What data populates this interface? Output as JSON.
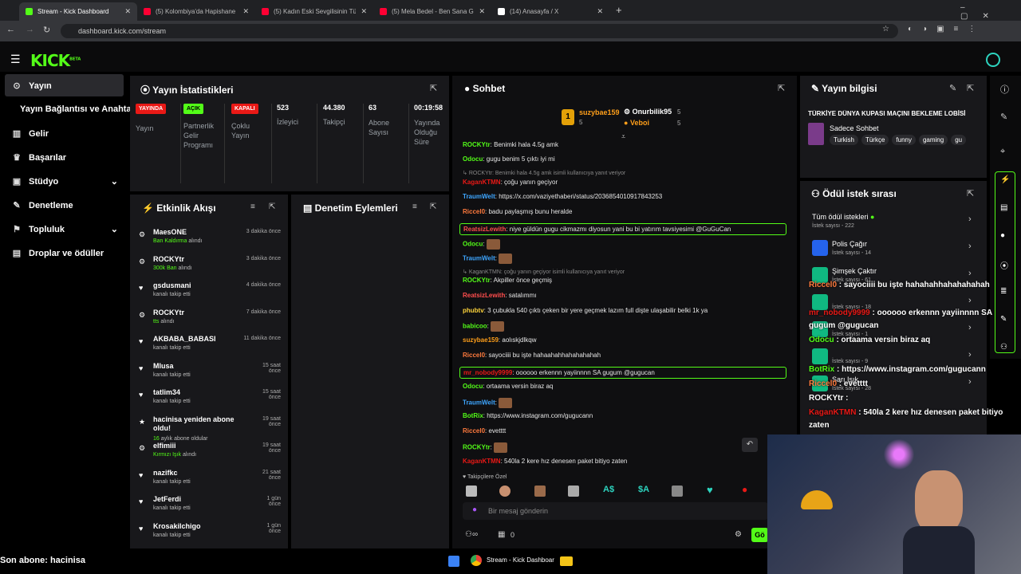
{
  "browser": {
    "tabs": [
      {
        "title": "Stream - Kick Dashboard",
        "color": "#53fc18"
      },
      {
        "title": "(5) Kolombiya'da Hapishane Ba",
        "color": "#ff0033"
      },
      {
        "title": "(5) Kadın Eski Sevgilisinin Tüm",
        "color": "#ff0033"
      },
      {
        "title": "(5) Mela Bedel - Ben Sana Gele",
        "color": "#ff0033"
      },
      {
        "title": "(14) Anasayfa / X",
        "color": "#ffffff"
      }
    ],
    "url": "dashboard.kick.com/stream"
  },
  "app": {
    "logo": "KICK",
    "logo_sup": "BETA"
  },
  "sidebar": {
    "items": [
      "Yayın",
      "Yayın Bağlantısı ve Anahtarı",
      "Gelir",
      "Başarılar",
      "Stüdyo",
      "Denetleme",
      "Topluluk",
      "Droplar ve ödüller"
    ]
  },
  "stats": {
    "title": "Yayın İstatistikleri",
    "items": [
      {
        "badge": "YAYINDA",
        "label": "Yayın",
        "color": "#e91916"
      },
      {
        "badge": "AÇIK",
        "label": "Partnerlik Gelir Programı",
        "color": "#53fc18"
      },
      {
        "badge": "KAPALI",
        "label": "Çoklu Yayın",
        "color": "#e91916"
      },
      {
        "value": "523",
        "label": "İzleyici"
      },
      {
        "value": "44.380",
        "label": "Takipçi"
      },
      {
        "value": "63",
        "label": "Abone Sayısı"
      },
      {
        "value": "00:19:58",
        "label": "Yayında Olduğu Süre"
      }
    ]
  },
  "activity": {
    "title": "Etkinlik Akışı",
    "items": [
      {
        "name": "MaesONE",
        "sub": "Ban Kaldırma",
        "sub2": " alındı",
        "time": "3 dakika önce",
        "icon": "⚙"
      },
      {
        "name": "ROCKYtr",
        "sub": "300k Ban",
        "sub2": " alındı",
        "time": "3 dakika önce",
        "icon": "⚙"
      },
      {
        "name": "gsdusmani",
        "sub": "",
        "sub2": "kanalı takip etti",
        "time": "4 dakika önce",
        "icon": "♥"
      },
      {
        "name": "ROCKYtr",
        "sub": "tts",
        "sub2": " alındı",
        "time": "7 dakika önce",
        "icon": "⚙"
      },
      {
        "name": "AKBABA_BABASI",
        "sub": "",
        "sub2": "kanalı takip etti",
        "time": "11 dakika önce",
        "icon": "♥"
      },
      {
        "name": "Mlusa",
        "sub": "",
        "sub2": "kanalı takip etti",
        "time": "15 saat önce",
        "icon": "♥"
      },
      {
        "name": "tatlim34",
        "sub": "",
        "sub2": "kanalı takip etti",
        "time": "15 saat önce",
        "icon": "♥"
      },
      {
        "name": "hacinisa yeniden abone oldu!",
        "sub": "16",
        "sub2": " aylık abone oldular",
        "time": "19 saat önce",
        "icon": "★"
      },
      {
        "name": "elfimiii",
        "sub": "Kırmızı Işık",
        "sub2": " alındı",
        "time": "19 saat önce",
        "icon": "⚙"
      },
      {
        "name": "nazifkc",
        "sub": "",
        "sub2": "kanalı takip etti",
        "time": "21 saat önce",
        "icon": "♥"
      },
      {
        "name": "JetFerdi",
        "sub": "",
        "sub2": "kanalı takip etti",
        "time": "1 gün önce",
        "icon": "♥"
      },
      {
        "name": "Krosakilchigo",
        "sub": "",
        "sub2": "kanalı takip etti",
        "time": "1 gün önce",
        "icon": "♥"
      }
    ]
  },
  "moderation": {
    "title": "Denetim Eylemleri"
  },
  "chat": {
    "title": "Sohbet",
    "top": [
      {
        "name": "suzybae159",
        "count": "5"
      },
      {
        "name": "Onurbilik95",
        "count": "5"
      },
      {
        "name": "Veboi",
        "count": "5"
      }
    ],
    "lines": [
      {
        "user": "ROCKYtr",
        "color": "#53fc18",
        "text": ": Benimki hala 4.5g amk"
      },
      {
        "user": "Odocu",
        "color": "#53fc18",
        "text": ": gugu benim 5 çıktı iyi mi"
      },
      {
        "reply": "ROCKYtr: Benimki hala 4.5g amk isimli kullanıcıya yanıt veriyor"
      },
      {
        "user": "KaganKTMN",
        "color": "#e91916",
        "text": ": çoğu yanın geçiyor"
      },
      {
        "user": "TraumWelt",
        "color": "#3ea6ff",
        "text": ": https://x.com/vaziyethaberi/status/2036854010917843253"
      },
      {
        "user": "Riccel0",
        "color": "#ff7a3d",
        "text": ": badu paylaşmış bunu heralde"
      },
      {
        "user": "ReatsizLewith",
        "color": "#ff4d4d",
        "text": ": niye güldün gugu cikmazmı diyosun yani bu bi yatırım tavsiyesimi @GuGuCan",
        "hl": true
      },
      {
        "user": "Odocu",
        "color": "#53fc18",
        "text": ":"
      },
      {
        "user": "TraumWelt",
        "color": "#3ea6ff",
        "text": ":"
      },
      {
        "reply": "KaganKTMN: çoğu yanın geçiyor isimli kullanıcıya yanıt veriyor"
      },
      {
        "user": "ROCKYtr",
        "color": "#53fc18",
        "text": ": Akpiller önce geçmiş"
      },
      {
        "user": "ReatsizLewith",
        "color": "#ff4d4d",
        "text": ": satalımmı"
      },
      {
        "user": "phubtv",
        "color": "#ffd43b",
        "text": ": 3 çubukla 540 çıktı çeken bir yere geçmek lazım full dişte ulaşabilir belki 1k ya"
      },
      {
        "user": "babicoo",
        "color": "#53fc18",
        "text": ":"
      },
      {
        "user": "suzybae159",
        "color": "#ff9f1a",
        "text": ": aolıskjdlkqw"
      },
      {
        "user": "Riccel0",
        "color": "#ff7a3d",
        "text": ": sayociiii bu işte hahaahahhahahahahah"
      },
      {
        "user": "mr_nobody9999",
        "color": "#e91916",
        "text": ": oooooo erkennn yayiinnnn SA gugum @gugucan",
        "hl": true
      },
      {
        "user": "Odocu",
        "color": "#53fc18",
        "text": ": ortaama versin biraz aq"
      },
      {
        "user": "TraumWelt",
        "color": "#3ea6ff",
        "text": ":"
      },
      {
        "user": "BotRix",
        "color": "#53fc18",
        "text": ": https://www.instagram.com/gugucann"
      },
      {
        "user": "Riccel0",
        "color": "#ff7a3d",
        "text": ": evetttt"
      },
      {
        "user": "ROCKYtr",
        "color": "#53fc18",
        "text": ":"
      },
      {
        "user": "KaganKTMN",
        "color": "#e91916",
        "text": ": 540la 2 kere hız denesen paket bitiyo zaten"
      }
    ],
    "followers_label": "Takipçilere Özel",
    "input_placeholder": "Bir mesaj gönderin",
    "bottom_count": "0",
    "send_label": "Gö"
  },
  "info": {
    "title": "Yayın bilgisi",
    "stream_title": "TÜRKİYE DÜNYA KUPASI MAÇINI BEKLEME LOBİSİ",
    "category": "Sadece Sohbet",
    "tags": [
      "Turkish",
      "Türkçe",
      "funny",
      "gaming",
      "gu"
    ]
  },
  "rewards": {
    "title": "Ödül istek sırası",
    "items": [
      {
        "name": "Tüm ödül istekleri",
        "sub": "İstek sayısı - 222"
      },
      {
        "name": "Polis Çağır",
        "sub": "İstek sayısı - 14"
      },
      {
        "name": "Şimşek Çaktır",
        "sub": "İstek sayısı - 61"
      },
      {
        "name": "",
        "sub": "İstek sayısı - 18"
      },
      {
        "name": "",
        "sub": "İstek sayısı - 1"
      },
      {
        "name": "",
        "sub": "İstek sayısı - 9"
      },
      {
        "name": "Sarı Işık",
        "sub": "İstek sayısı - 28"
      }
    ]
  },
  "overlay": {
    "lines": [
      {
        "user": "Riccel0",
        "color": "#ff7a3d",
        "text": " : sayociiii bu işte hahahahhahahahahah"
      },
      {
        "user": "mr_nobody9999",
        "color": "#e91916",
        "text": " : oooooo erkennn yayiinnnn SA gugum @gugucan"
      },
      {
        "user": "Odocu",
        "color": "#53fc18",
        "text": " : ortaama versin biraz aq"
      },
      {
        "user": "BotRix",
        "color": "#53fc18",
        "text": " : https://www.instagram.com/gugucann"
      },
      {
        "user": "Riccel0",
        "color": "#ff7a3d",
        "text": " : evetttt"
      },
      {
        "user": "ROCKYtr :",
        "color": "#fff",
        "text": ""
      },
      {
        "user": "KaganKTMN",
        "color": "#e91916",
        "text": " : 540la 2 kere hız denesen paket bitiyo zaten"
      }
    ],
    "last_sub": "Son abone: hacinisa"
  },
  "taskbar": {
    "app_label": "Stream - Kick Dashboar"
  }
}
